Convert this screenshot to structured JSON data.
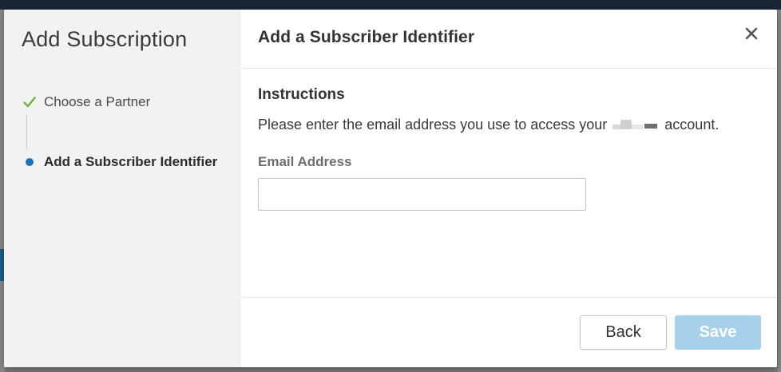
{
  "sidebar": {
    "title": "Add Subscription",
    "steps": [
      {
        "label": "Choose a Partner",
        "state": "completed",
        "icon": "check-icon"
      },
      {
        "label": "Add a Subscriber Identifier",
        "state": "active",
        "icon": "dot-icon"
      }
    ]
  },
  "header": {
    "title": "Add a Subscriber Identifier",
    "close_symbol": "×"
  },
  "body": {
    "section_title": "Instructions",
    "instruction_prefix": "Please enter the email address you use to access your",
    "instruction_suffix": "account.",
    "email_label": "Email Address",
    "email_value": "",
    "email_placeholder": ""
  },
  "footer": {
    "back_label": "Back",
    "save_label": "Save"
  },
  "colors": {
    "accent": "#1b75bb",
    "check": "#6bb33b",
    "save_disabled": "#a7d1ea",
    "sidebar_bg": "#f2f2f2"
  }
}
